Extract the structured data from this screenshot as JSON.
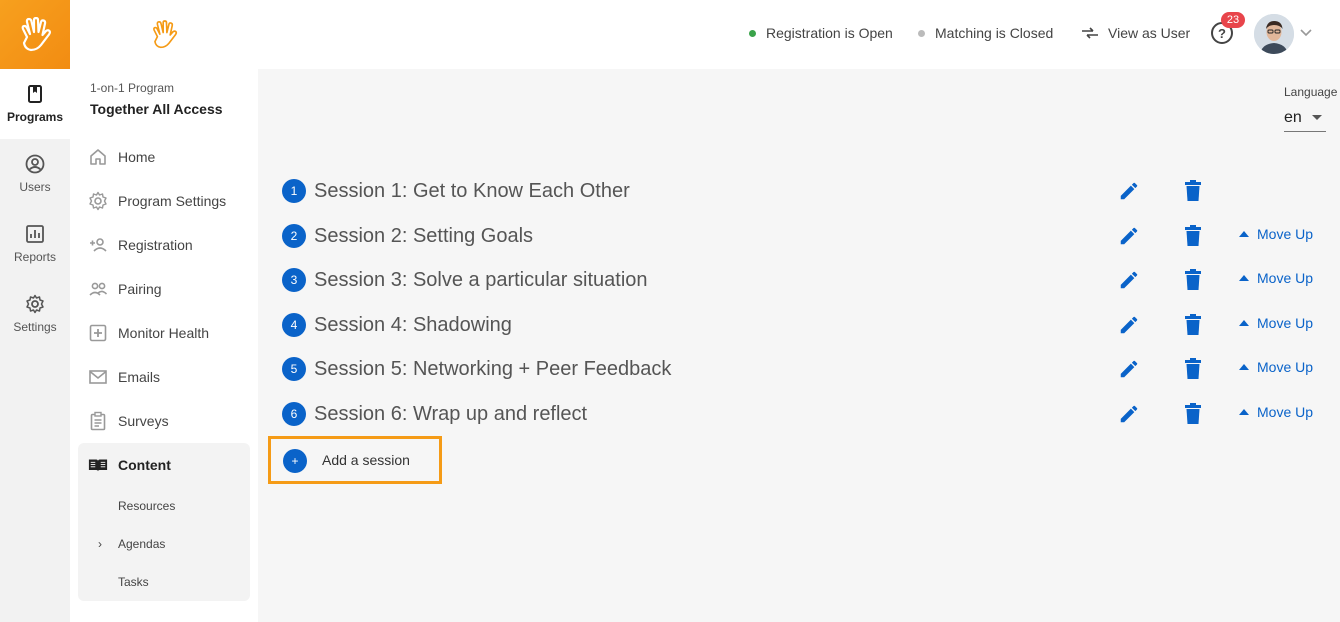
{
  "rail": {
    "items": [
      {
        "label": "Programs",
        "icon": "book-icon",
        "active": true
      },
      {
        "label": "Users",
        "icon": "user-circle-icon",
        "active": false
      },
      {
        "label": "Reports",
        "icon": "bar-chart-icon",
        "active": false
      },
      {
        "label": "Settings",
        "icon": "gear-icon",
        "active": false
      }
    ]
  },
  "program": {
    "subtitle": "1-on-1 Program",
    "title": "Together All Access"
  },
  "nav": {
    "items": [
      {
        "label": "Home",
        "icon": "home-icon"
      },
      {
        "label": "Program Settings",
        "icon": "gear-icon"
      },
      {
        "label": "Registration",
        "icon": "add-user-icon"
      },
      {
        "label": "Pairing",
        "icon": "users-icon"
      },
      {
        "label": "Monitor Health",
        "icon": "plus-square-icon"
      },
      {
        "label": "Emails",
        "icon": "mail-icon"
      },
      {
        "label": "Surveys",
        "icon": "clipboard-icon"
      }
    ],
    "content": {
      "label": "Content",
      "icon": "open-book-icon",
      "subitems": [
        "Resources",
        "Agendas",
        "Tasks"
      ]
    }
  },
  "topbar": {
    "registration_status": "Registration is Open",
    "matching_status": "Matching is Closed",
    "view_as_user": "View as User",
    "help": "?",
    "notification_count": "23",
    "colors": {
      "open": "#3aa34a",
      "closed": "#bbbbbb"
    }
  },
  "language": {
    "label": "Language",
    "value": "en"
  },
  "sessions": [
    {
      "num": "1",
      "title": "Session 1: Get to Know Each Other",
      "move_up": ""
    },
    {
      "num": "2",
      "title": "Session 2: Setting Goals",
      "move_up": "Move Up"
    },
    {
      "num": "3",
      "title": "Session 3: Solve a particular situation",
      "move_up": "Move Up"
    },
    {
      "num": "4",
      "title": "Session 4: Shadowing",
      "move_up": "Move Up"
    },
    {
      "num": "5",
      "title": "Session 5: Networking + Peer Feedback",
      "move_up": "Move Up"
    },
    {
      "num": "6",
      "title": "Session 6: Wrap up and reflect",
      "move_up": "Move Up"
    }
  ],
  "add_session": {
    "plus": "+",
    "label": "Add a session"
  },
  "colors": {
    "brand_orange": "#f59b16",
    "accent_blue": "#0a63c9",
    "badge_red": "#e8454b"
  }
}
